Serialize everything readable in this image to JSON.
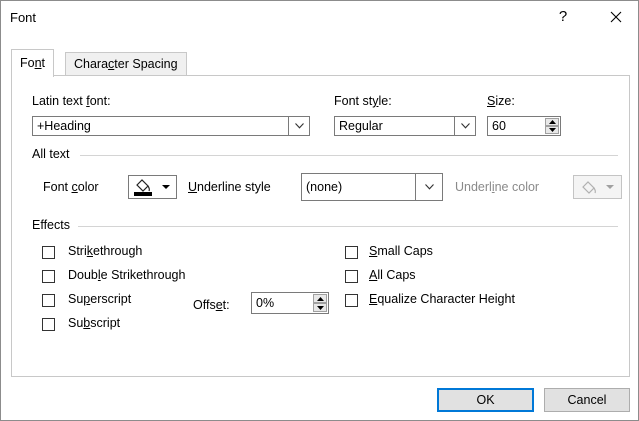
{
  "window": {
    "title": "Font",
    "help_label": "?"
  },
  "tabs": [
    {
      "label_pre": "Fo",
      "label_u": "n",
      "label_post": "t",
      "active": true
    },
    {
      "label_pre": "Chara",
      "label_u": "c",
      "label_post": "ter Spacing",
      "active": false
    }
  ],
  "font": {
    "latin_label_pre": "Latin text ",
    "latin_label_u": "f",
    "latin_label_post": "ont:",
    "latin_value": "+Heading",
    "style_label_pre": "Font st",
    "style_label_u": "y",
    "style_label_post": "le:",
    "style_value": "Regular",
    "size_label_pre": "",
    "size_label_u": "S",
    "size_label_post": "ize:",
    "size_value": "60"
  },
  "all_text": {
    "heading": "All text",
    "font_color_pre": "Font ",
    "font_color_u": "c",
    "font_color_post": "olor",
    "font_color_value": "#000000",
    "underline_style_pre": "",
    "underline_style_u": "U",
    "underline_style_post": "nderline style",
    "underline_style_value": "(none)",
    "underline_color_pre": "Underl",
    "underline_color_u": "i",
    "underline_color_post": "ne color"
  },
  "effects": {
    "heading": "Effects",
    "strikethrough": {
      "pre": "Stri",
      "u": "k",
      "post": "ethrough",
      "checked": false
    },
    "double_strikethrough": {
      "pre": "Doub",
      "u": "l",
      "post": "e Strikethrough",
      "checked": false
    },
    "superscript": {
      "pre": "Su",
      "u": "p",
      "post": "erscript",
      "checked": false
    },
    "subscript": {
      "pre": "Su",
      "u": "b",
      "post": "script",
      "checked": false
    },
    "offset_pre": "Offs",
    "offset_u": "e",
    "offset_post": "t:",
    "offset_value": "0%",
    "small_caps": {
      "pre": "",
      "u": "S",
      "post": "mall Caps",
      "checked": false
    },
    "all_caps": {
      "pre": "",
      "u": "A",
      "post": "ll Caps",
      "checked": false
    },
    "equalize": {
      "pre": "",
      "u": "E",
      "post": "qualize Character Height",
      "checked": false
    }
  },
  "buttons": {
    "ok": "OK",
    "cancel": "Cancel"
  },
  "colors": {
    "accent": "#0078d7"
  }
}
